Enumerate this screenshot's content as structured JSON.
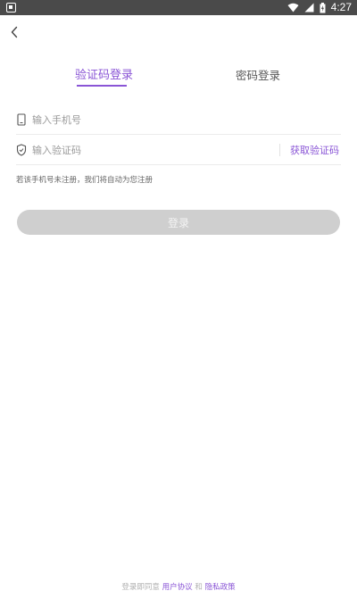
{
  "status_bar": {
    "time": "4:27",
    "icons": [
      "app-notification-icon",
      "wifi-icon",
      "cell-signal-icon",
      "battery-icon"
    ]
  },
  "header": {
    "back_icon": "chevron-left-icon"
  },
  "tabs": [
    {
      "label": "验证码登录",
      "active": true
    },
    {
      "label": "密码登录",
      "active": false
    }
  ],
  "form": {
    "phone_placeholder": "输入手机号",
    "phone_icon": "phone-icon",
    "code_placeholder": "输入验证码",
    "code_icon": "shield-icon",
    "get_code_label": "获取验证码"
  },
  "hint_text": "若该手机号未注册，我们将自动为您注册",
  "login_label": "登录",
  "agreement": {
    "prefix": "登录即同意",
    "user_agreement": "用户协议",
    "and": "和",
    "privacy_policy": "隐私政策"
  },
  "colors": {
    "accent": "#8a55d6",
    "status_bar_bg": "#4a4a4a",
    "button_disabled_bg": "#cfcfcf"
  }
}
